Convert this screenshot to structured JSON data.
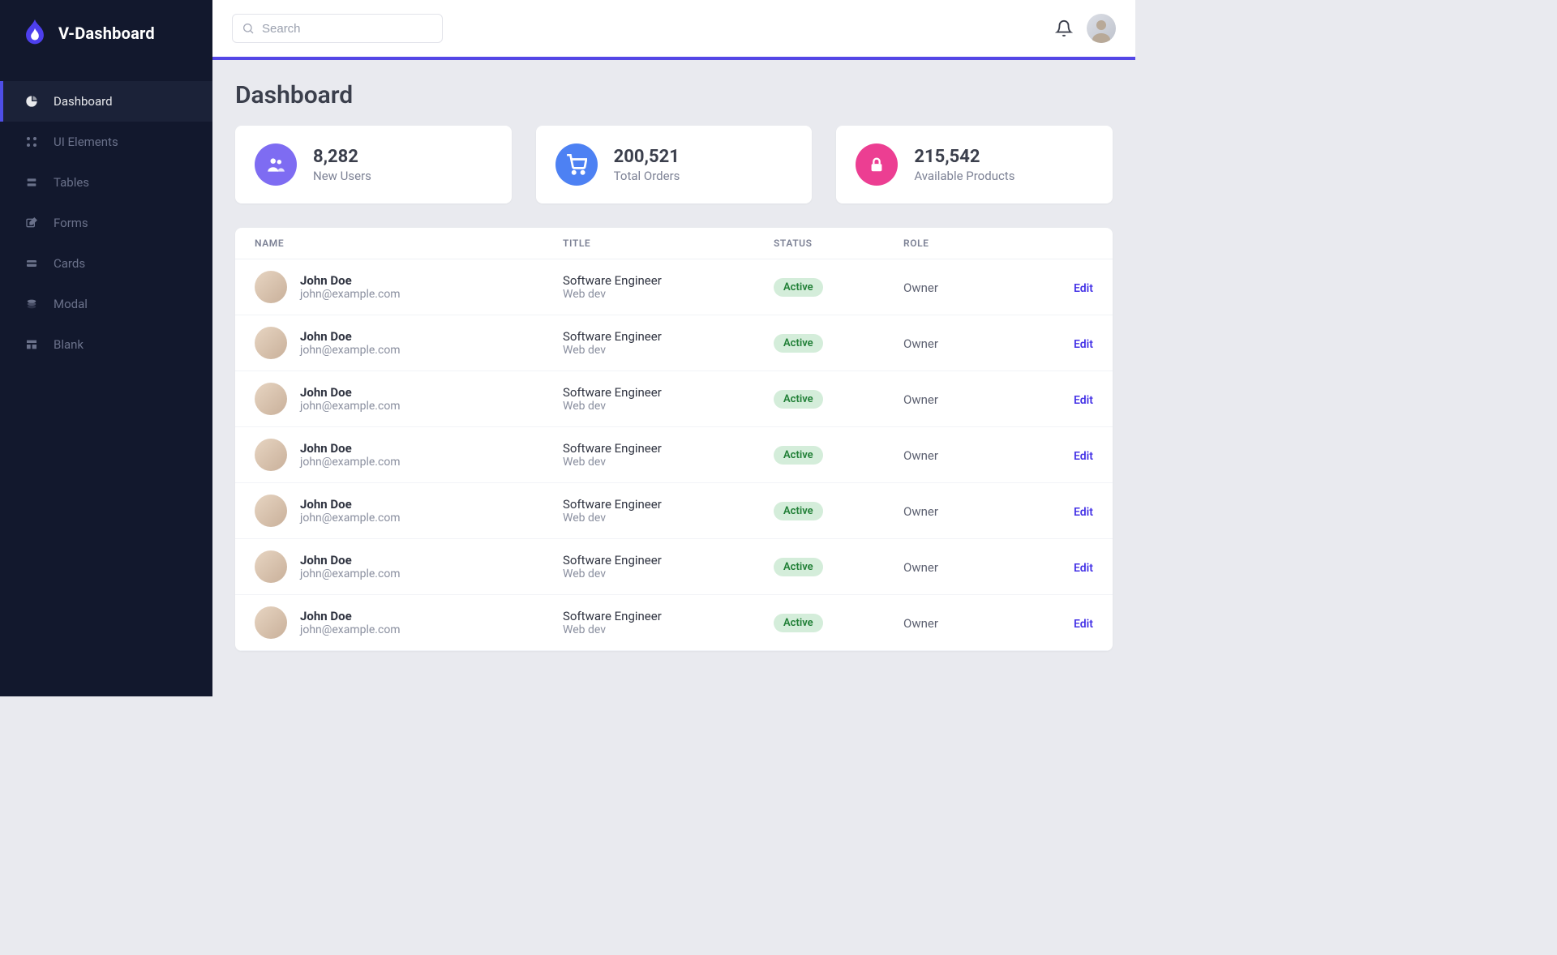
{
  "brand": {
    "name": "V-Dashboard"
  },
  "search": {
    "placeholder": "Search"
  },
  "sidebar": {
    "items": [
      {
        "label": "Dashboard",
        "icon": "pie-chart-icon",
        "active": true
      },
      {
        "label": "UI Elements",
        "icon": "grid-dots-icon",
        "active": false
      },
      {
        "label": "Tables",
        "icon": "stack-icon",
        "active": false
      },
      {
        "label": "Forms",
        "icon": "edit-square-icon",
        "active": false
      },
      {
        "label": "Cards",
        "icon": "credit-card-icon",
        "active": false
      },
      {
        "label": "Modal",
        "icon": "layers-icon",
        "active": false
      },
      {
        "label": "Blank",
        "icon": "layout-icon",
        "active": false
      }
    ]
  },
  "page": {
    "title": "Dashboard"
  },
  "stats": [
    {
      "value": "8,282",
      "label": "New Users",
      "icon": "users-icon",
      "color": "c-indigo"
    },
    {
      "value": "200,521",
      "label": "Total Orders",
      "icon": "shopping-cart-icon",
      "color": "c-blue"
    },
    {
      "value": "215,542",
      "label": "Available Products",
      "icon": "lock-icon",
      "color": "c-pink"
    }
  ],
  "table": {
    "columns": {
      "name": "NAME",
      "title": "TITLE",
      "status": "STATUS",
      "role": "ROLE"
    },
    "edit_label": "Edit",
    "rows": [
      {
        "name": "John Doe",
        "email": "john@example.com",
        "title": "Software Engineer",
        "subtitle": "Web dev",
        "status": "Active",
        "role": "Owner"
      },
      {
        "name": "John Doe",
        "email": "john@example.com",
        "title": "Software Engineer",
        "subtitle": "Web dev",
        "status": "Active",
        "role": "Owner"
      },
      {
        "name": "John Doe",
        "email": "john@example.com",
        "title": "Software Engineer",
        "subtitle": "Web dev",
        "status": "Active",
        "role": "Owner"
      },
      {
        "name": "John Doe",
        "email": "john@example.com",
        "title": "Software Engineer",
        "subtitle": "Web dev",
        "status": "Active",
        "role": "Owner"
      },
      {
        "name": "John Doe",
        "email": "john@example.com",
        "title": "Software Engineer",
        "subtitle": "Web dev",
        "status": "Active",
        "role": "Owner"
      },
      {
        "name": "John Doe",
        "email": "john@example.com",
        "title": "Software Engineer",
        "subtitle": "Web dev",
        "status": "Active",
        "role": "Owner"
      },
      {
        "name": "John Doe",
        "email": "john@example.com",
        "title": "Software Engineer",
        "subtitle": "Web dev",
        "status": "Active",
        "role": "Owner"
      }
    ]
  }
}
